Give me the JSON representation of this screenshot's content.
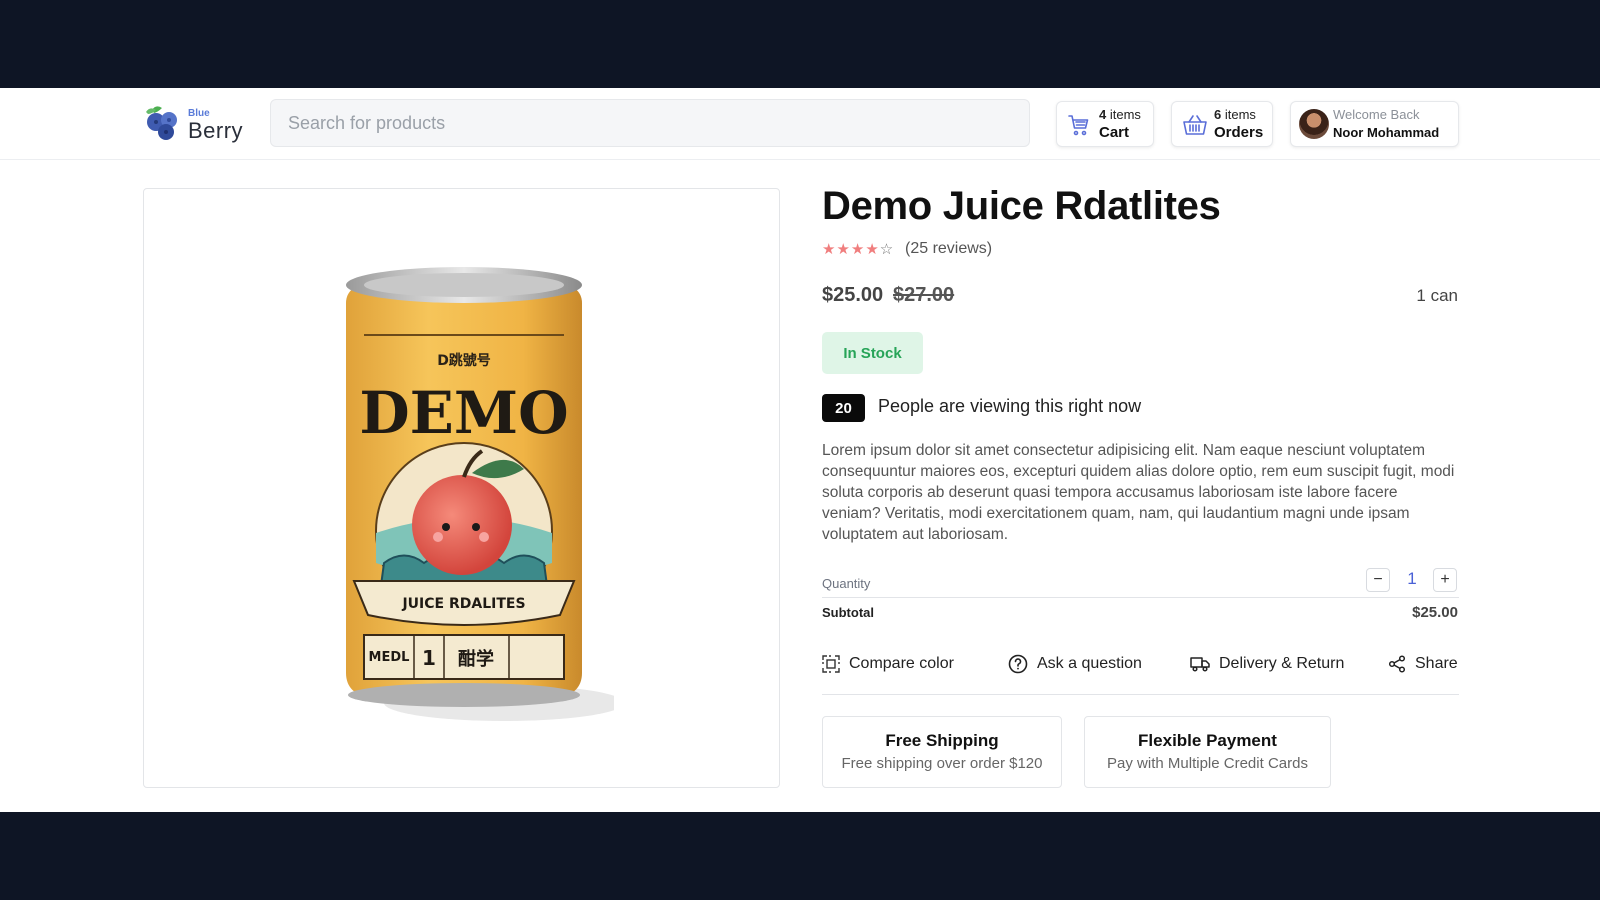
{
  "header": {
    "logo_small": "Blue",
    "logo_big": "Berry",
    "search_placeholder": "Search for products",
    "cart": {
      "count": "4",
      "count_suffix": " items",
      "label": "Cart",
      "icon": "cart-icon"
    },
    "orders": {
      "count": "6",
      "count_suffix": " items",
      "label": "Orders",
      "icon": "basket-icon"
    },
    "user": {
      "greeting": "Welcome Back",
      "name": "Noor Mohammad"
    }
  },
  "product": {
    "title": "Demo Juice Rdatlites",
    "rating": 4,
    "rating_max": 5,
    "reviews": "(25 reviews)",
    "price": "$25.00",
    "old_price": "$27.00",
    "unit": "1 can",
    "stock": "In Stock",
    "viewers_count": "20",
    "viewers_text": "People are viewing this right now",
    "description": "Lorem ipsum dolor sit amet consectetur adipisicing elit. Nam eaque nesciunt voluptatem consequuntur maiores eos, excepturi quidem alias dolore optio, rem eum suscipit fugit, modi soluta corporis ab deserunt quasi tempora accusamus laboriosam iste labore facere veniam? Veritatis, modi exercitationem quam, nam, qui laudantium magni unde ipsam voluptatem aut laboriosam.",
    "image": {
      "brand": "DEMO",
      "label_top": "D跳號号",
      "banner": "JUICE RDALITES",
      "bottom_left": "MEDL",
      "bottom_mid": "1",
      "bottom_right": "酣学"
    }
  },
  "quantity": {
    "label": "Quantity",
    "value": "1",
    "minus": "−",
    "plus": "+"
  },
  "subtotal": {
    "label": "Subtotal",
    "value": "$25.00"
  },
  "actions": {
    "compare": "Compare color",
    "ask": "Ask a question",
    "delivery": "Delivery & Return",
    "share": "Share"
  },
  "features": {
    "shipping_title": "Free Shipping",
    "shipping_sub": "Free shipping over order $120",
    "payment_title": "Flexible Payment",
    "payment_sub": "Pay with Multiple Credit Cards"
  },
  "colors": {
    "accent": "#4a61d6",
    "stock_bg": "#dff5e7",
    "stock_text": "#27a458",
    "star": "#f07e7e",
    "frame": "#0e1525"
  }
}
